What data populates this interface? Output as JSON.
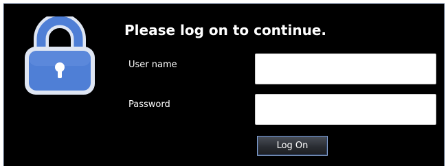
{
  "dialog": {
    "title": "Please log on to continue.",
    "username_label": "User name",
    "password_label": "Password",
    "username_value": "",
    "password_value": "",
    "logon_label": "Log On",
    "icon": "lock-icon"
  },
  "colors": {
    "background": "#000000",
    "lock_body": "#4f7fd6",
    "lock_border": "#dfe6f3",
    "button_border": "#8aa8d8"
  }
}
